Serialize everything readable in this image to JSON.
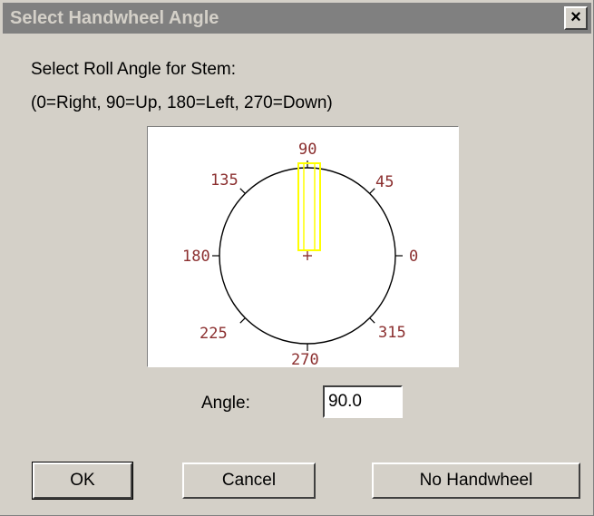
{
  "window": {
    "title": "Select Handwheel Angle",
    "close_label": "×"
  },
  "labels": {
    "prompt": "Select Roll Angle for Stem:",
    "legend": "(0=Right, 90=Up, 180=Left, 270=Down)",
    "angle_label": "Angle:"
  },
  "dial": {
    "tick_labels": {
      "t0": "0",
      "t45": "45",
      "t90": "90",
      "t135": "135",
      "t180": "180",
      "t225": "225",
      "t270": "270",
      "t315": "315"
    },
    "selected_angle_deg": 90,
    "stem_color": "#ffff00",
    "tick_label_color": "#8b2f2f"
  },
  "angle_field": {
    "value": "90.0"
  },
  "buttons": {
    "ok": "OK",
    "cancel": "Cancel",
    "no_handwheel": "No Handwheel"
  }
}
